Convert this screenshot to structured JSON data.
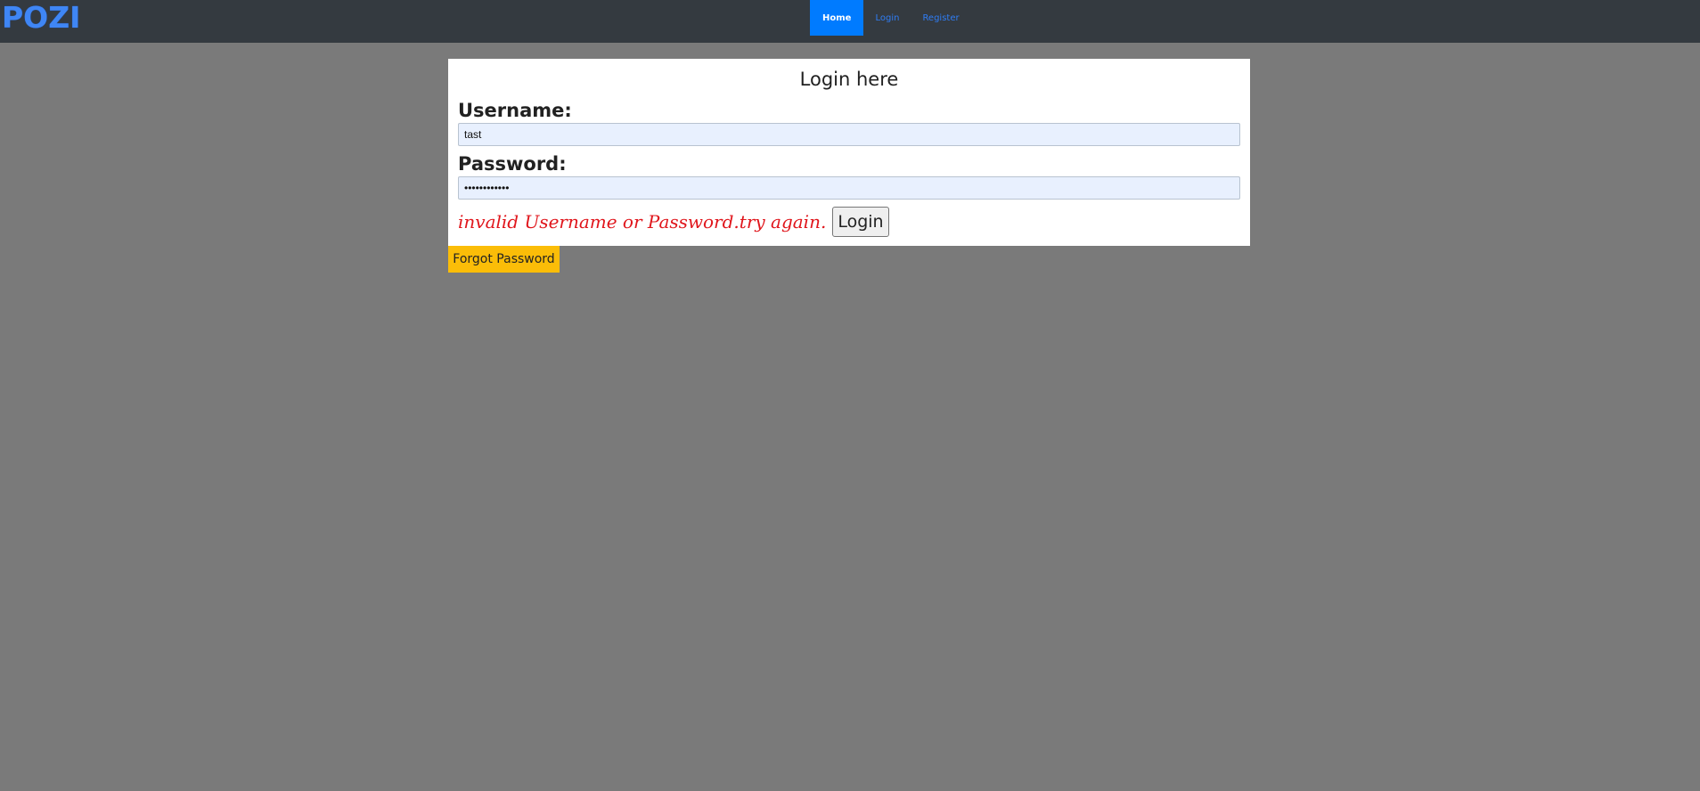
{
  "navbar": {
    "logo": "POZI",
    "items": [
      {
        "label": "Home",
        "active": true
      },
      {
        "label": "Login",
        "active": false
      },
      {
        "label": "Register",
        "active": false
      }
    ]
  },
  "login_card": {
    "title": "Login here",
    "username_label": "Username:",
    "username_value": "tast",
    "password_label": "Password:",
    "password_value": "••••••••••••",
    "error_message": "invalid Username or Password.try again.",
    "login_button": "Login"
  },
  "forgot_password_button": "Forgot Password",
  "colors": {
    "navbar_bg": "#343a40",
    "page_bg": "#7a7a7a",
    "active_nav": "#007bff",
    "error": "#e0161c",
    "forgot_button": "#fbbd08"
  }
}
